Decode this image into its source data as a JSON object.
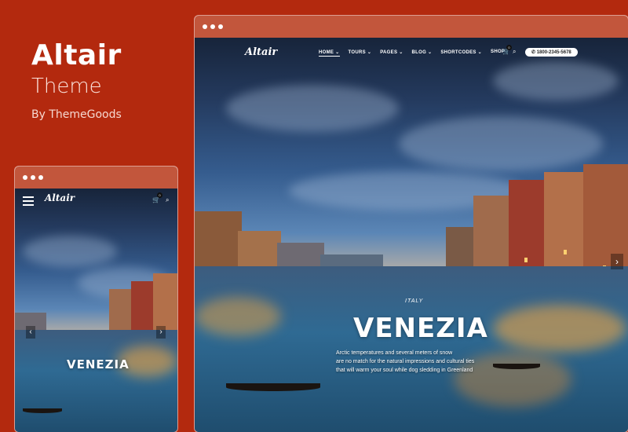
{
  "promo": {
    "title": "Altair",
    "subtitle": "Theme",
    "byline": "By ThemeGoods"
  },
  "desktop": {
    "logo": "Altair",
    "menu": [
      {
        "label": "HOME ⌄",
        "active": true
      },
      {
        "label": "TOURS ⌄",
        "active": false
      },
      {
        "label": "PAGES ⌄",
        "active": false
      },
      {
        "label": "BLOG ⌄",
        "active": false
      },
      {
        "label": "SHORTCODES ⌄",
        "active": false
      },
      {
        "label": "SHOP",
        "active": false
      }
    ],
    "cart_count": "0",
    "phone": "1800-2345-5678",
    "hero": {
      "eyebrow": "ITALY",
      "title": "VENEZIA",
      "text_line1": "Arctic temperatures and several meters of snow",
      "text_line2": "are no match for the natural impressions and cultural ties",
      "text_line3": "that will warm your soul while dog sledding in Greenland"
    }
  },
  "mobile": {
    "logo": "Altair",
    "cart_count": "0",
    "hero": {
      "title": "VENEZIA"
    }
  },
  "icons": {
    "cart": "cart-icon",
    "search": "search-icon",
    "phone": "phone-icon",
    "menu": "hamburger-icon",
    "prev": "chevron-left-icon",
    "next": "chevron-right-icon"
  },
  "colors": {
    "background": "#b3290e",
    "titlebar": "#c2563c"
  }
}
